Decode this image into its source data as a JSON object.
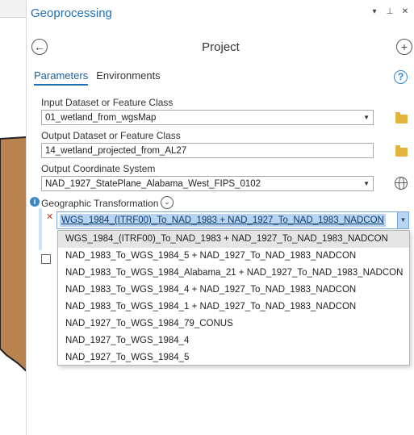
{
  "pane": {
    "title": "Geoprocessing",
    "controls": [
      "▾",
      "⊥",
      "✕"
    ]
  },
  "tool": {
    "name": "Project",
    "back_glyph": "←",
    "add_glyph": "+"
  },
  "tabs": [
    {
      "label": "Parameters",
      "active": true
    },
    {
      "label": "Environments",
      "active": false
    }
  ],
  "help_glyph": "?",
  "fields": {
    "input_label": "Input Dataset or Feature Class",
    "input_value": "01_wetland_from_wgsMap",
    "output_label": "Output Dataset or Feature Class",
    "output_value": "14_wetland_projected_from_AL27",
    "coord_label": "Output Coordinate System",
    "coord_value": "NAD_1927_StatePlane_Alabama_West_FIPS_0102",
    "gt_label": "Geographic Transformation",
    "gt_value": "WGS_1984_(ITRF00)_To_NAD_1983 + NAD_1927_To_NAD_1983_NADCON"
  },
  "dropdown_options": [
    "WGS_1984_(ITRF00)_To_NAD_1983 + NAD_1927_To_NAD_1983_NADCON",
    "NAD_1983_To_WGS_1984_5 + NAD_1927_To_NAD_1983_NADCON",
    "NAD_1983_To_WGS_1984_Alabama_21 + NAD_1927_To_NAD_1983_NADCON",
    "NAD_1983_To_WGS_1984_4 + NAD_1927_To_NAD_1983_NADCON",
    "NAD_1983_To_WGS_1984_1 + NAD_1927_To_NAD_1983_NADCON",
    "NAD_1927_To_WGS_1984_79_CONUS",
    "NAD_1927_To_WGS_1984_4",
    "NAD_1927_To_WGS_1984_5"
  ],
  "colors": {
    "accent": "#1f6fb5",
    "map_fill": "#b9834f",
    "selection": "#b8d4f1",
    "error": "#c0392b"
  }
}
